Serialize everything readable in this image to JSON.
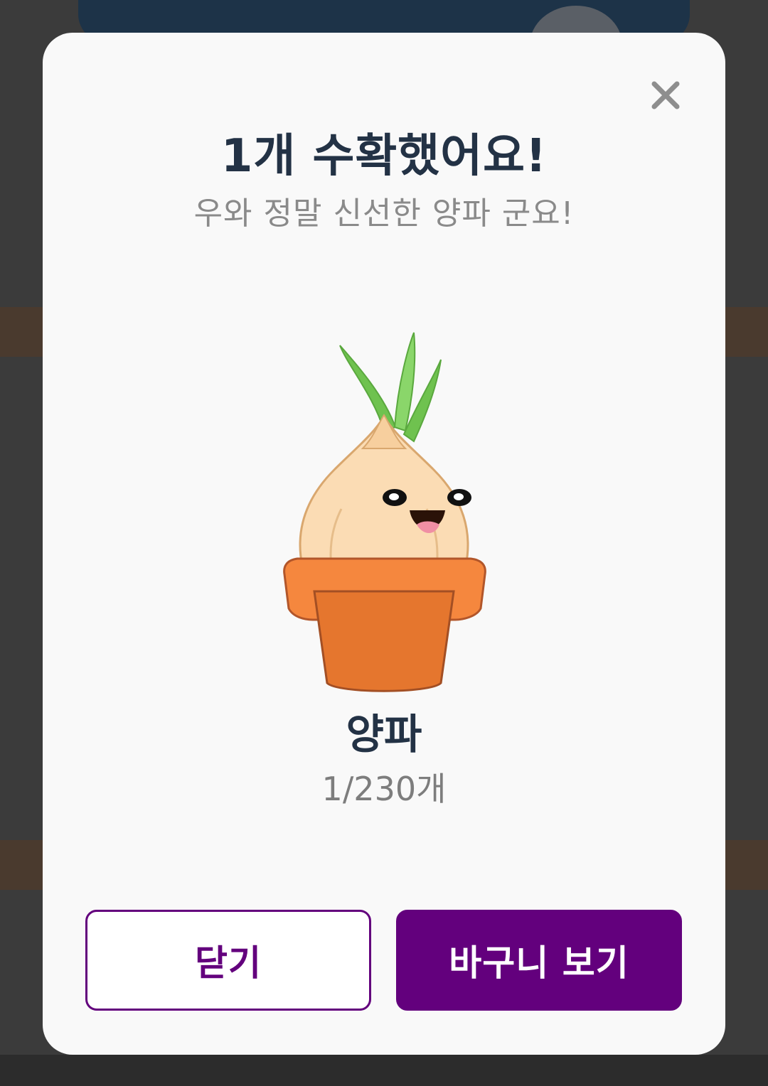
{
  "modal": {
    "title": "1개 수확했어요!",
    "subtitle": "우와 정말 신선한 양파 군요!",
    "item_name": "양파",
    "item_count": "1/230개",
    "close_icon": "close-icon",
    "illustration": "onion-in-pot",
    "buttons": {
      "close_label": "닫기",
      "basket_label": "바구니 보기"
    }
  },
  "colors": {
    "accent": "#63007d",
    "title_text": "#233245",
    "muted_text": "#8a8a8a",
    "modal_bg": "#f9f9f9",
    "overlay_bg": "#3b3b3b"
  }
}
